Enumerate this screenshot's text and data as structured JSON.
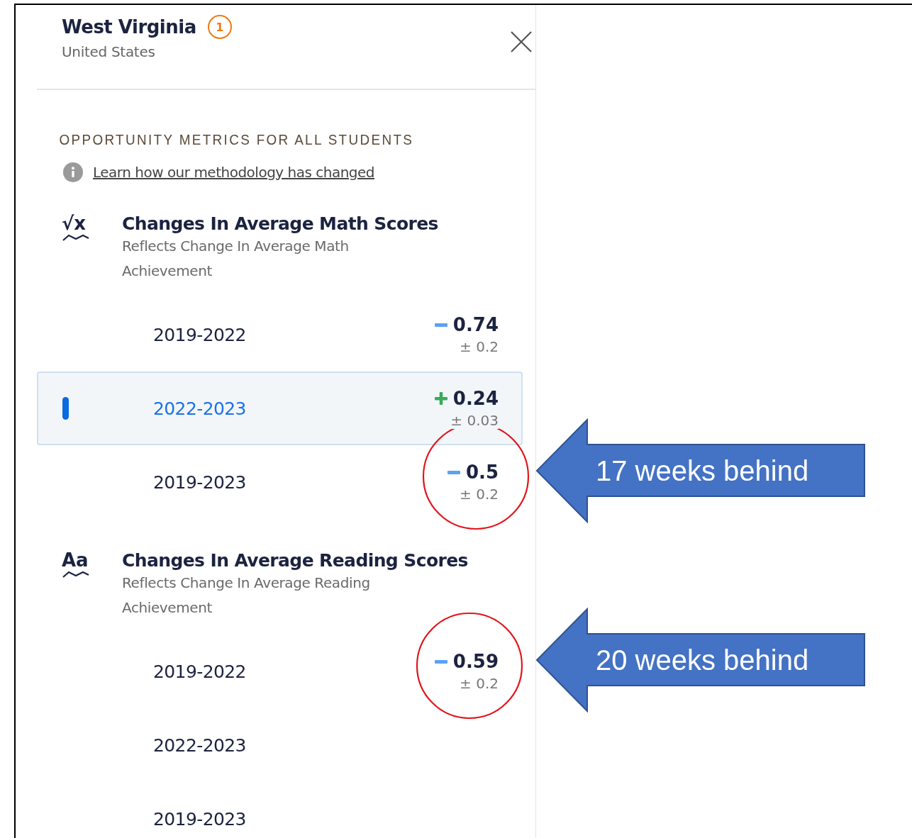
{
  "header": {
    "title": "West Virginia",
    "badge": "1",
    "subtitle": "United States"
  },
  "section_heading": "OPPORTUNITY METRICS FOR ALL STUDENTS",
  "info_link": "Learn how our methodology has changed",
  "metrics": [
    {
      "icon_text": "√x",
      "title": "Changes In Average Math Scores",
      "description": "Reflects Change In Average Math Achievement",
      "rows": [
        {
          "period": "2019-2022",
          "selected": false,
          "kind": "decrease",
          "value": "0.74",
          "margin": "± 0.2"
        },
        {
          "period": "2022-2023",
          "selected": true,
          "kind": "increase",
          "value": "0.24",
          "margin": "± 0.03"
        },
        {
          "period": "2019-2023",
          "selected": false,
          "kind": "decrease",
          "value": "0.5",
          "margin": "± 0.2",
          "circled": true,
          "callout": "17 weeks behind"
        }
      ]
    },
    {
      "icon_text": "Aa",
      "title": "Changes In Average Reading Scores",
      "description": "Reflects Change In Average Reading Achievement",
      "rows": [
        {
          "period": "2019-2022",
          "selected": false,
          "kind": "decrease",
          "value": "0.59",
          "margin": "± 0.2",
          "circled": true,
          "callout": "20 weeks behind"
        },
        {
          "period": "2022-2023",
          "selected": false
        },
        {
          "period": "2019-2023",
          "selected": false
        }
      ]
    }
  ]
}
